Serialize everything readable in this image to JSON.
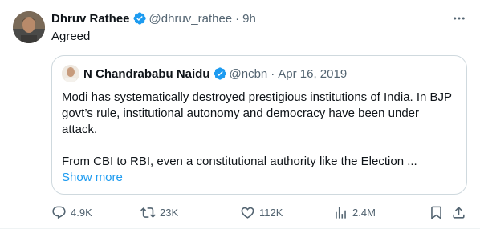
{
  "tweet": {
    "author": {
      "name": "Dhruv Rathee",
      "handle": "@dhruv_rathee",
      "time": "9h",
      "verified": true
    },
    "separator": "·",
    "text": "Agreed",
    "quoted": {
      "author": {
        "name": "N Chandrababu Naidu",
        "handle": "@ncbn",
        "date": "Apr 16, 2019",
        "verified": true
      },
      "separator": "·",
      "paragraph1": "Modi has systematically destroyed prestigious institutions of India. In BJP govt’s rule, institutional autonomy and democracy have been under attack.",
      "paragraph2": "From CBI to RBI, even a constitutional authority like the Election ...",
      "show_more": "Show more"
    },
    "actions": {
      "replies": "4.9K",
      "retweets": "23K",
      "likes": "112K",
      "views": "2.4M"
    }
  },
  "colors": {
    "accent": "#1d9bf0",
    "text": "#0f1419",
    "muted": "#536471",
    "border": "#cfd9de"
  },
  "icons": [
    "more-icon",
    "verified-badge-icon",
    "reply-icon",
    "retweet-icon",
    "like-icon",
    "views-icon",
    "bookmark-icon",
    "share-icon"
  ]
}
